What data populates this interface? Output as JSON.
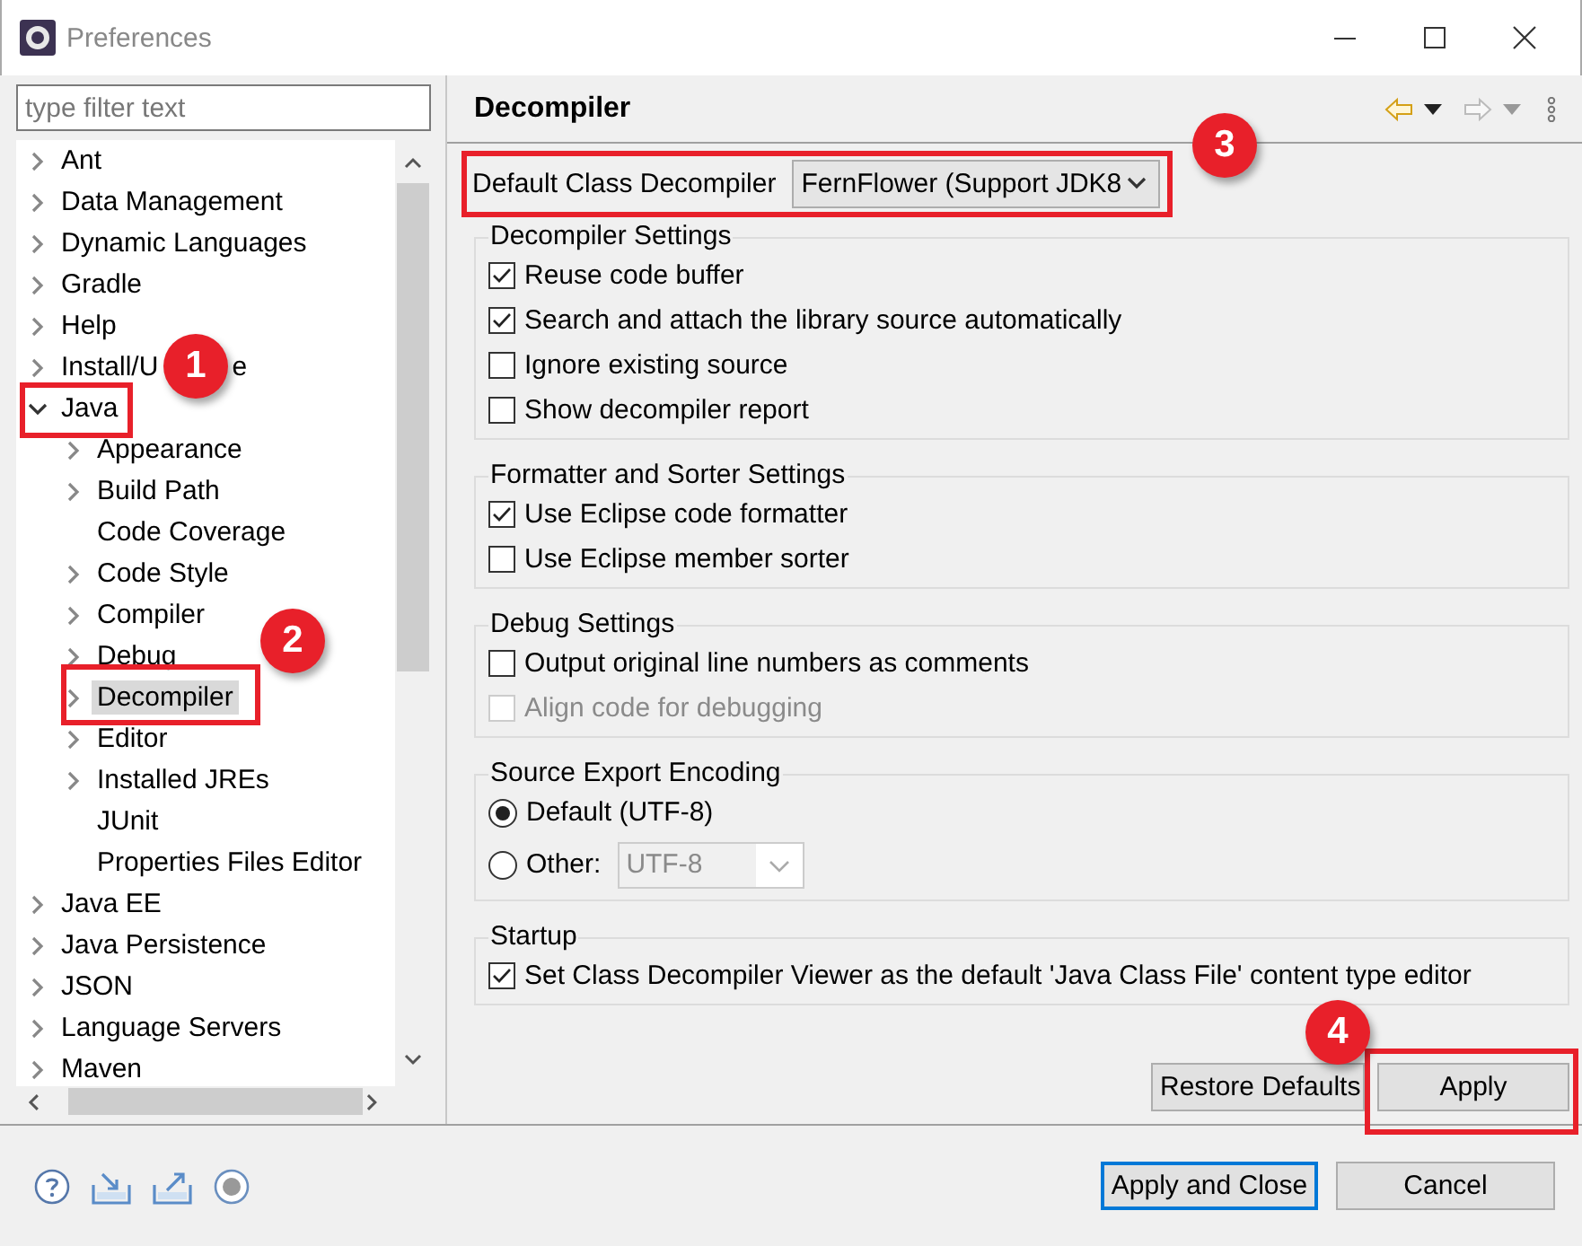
{
  "window": {
    "title": "Preferences"
  },
  "filter": {
    "placeholder": "type filter text"
  },
  "tree": [
    {
      "label": "Ant",
      "kind": "folder",
      "expanded": false,
      "selected": false
    },
    {
      "label": "Data Management",
      "kind": "folder",
      "expanded": false,
      "selected": false
    },
    {
      "label": "Dynamic Languages",
      "kind": "folder",
      "expanded": false,
      "selected": false
    },
    {
      "label": "Gradle",
      "kind": "folder",
      "expanded": false,
      "selected": false
    },
    {
      "label": "Help",
      "kind": "folder",
      "expanded": false,
      "selected": false
    },
    {
      "label": "Install/U",
      "label_tail": "e",
      "kind": "folder",
      "expanded": false,
      "selected": false
    },
    {
      "label": "Java",
      "kind": "folder",
      "expanded": true,
      "selected": false,
      "children": [
        {
          "label": "Appearance",
          "kind": "folder",
          "expanded": false,
          "selected": false
        },
        {
          "label": "Build Path",
          "kind": "folder",
          "expanded": false,
          "selected": false
        },
        {
          "label": "Code Coverage",
          "kind": "leaf",
          "selected": false
        },
        {
          "label": "Code Style",
          "kind": "folder",
          "expanded": false,
          "selected": false
        },
        {
          "label": "Compiler",
          "kind": "folder",
          "expanded": false,
          "selected": false
        },
        {
          "label": "Debug",
          "kind": "folder",
          "expanded": false,
          "selected": false
        },
        {
          "label": "Decompiler",
          "kind": "folder",
          "expanded": false,
          "selected": true
        },
        {
          "label": "Editor",
          "kind": "folder",
          "expanded": false,
          "selected": false
        },
        {
          "label": "Installed JREs",
          "kind": "folder",
          "expanded": false,
          "selected": false
        },
        {
          "label": "JUnit",
          "kind": "leaf",
          "selected": false
        },
        {
          "label": "Properties Files Editor",
          "kind": "leaf",
          "selected": false
        }
      ]
    },
    {
      "label": "Java EE",
      "kind": "folder",
      "expanded": false,
      "selected": false
    },
    {
      "label": "Java Persistence",
      "kind": "folder",
      "expanded": false,
      "selected": false
    },
    {
      "label": "JSON",
      "kind": "folder",
      "expanded": false,
      "selected": false
    },
    {
      "label": "Language Servers",
      "kind": "folder",
      "expanded": false,
      "selected": false
    },
    {
      "label": "Maven",
      "kind": "folder",
      "expanded": false,
      "selected": false
    }
  ],
  "page": {
    "title": "Decompiler"
  },
  "decompiler_choice": {
    "label": "Default Class Decompiler",
    "value": "FernFlower (Support JDK8"
  },
  "groups": [
    {
      "title": "Decompiler Settings",
      "options": [
        {
          "kind": "checkbox",
          "label": "Reuse code buffer",
          "checked": true,
          "disabled": false
        },
        {
          "kind": "checkbox",
          "label": "Search and attach the library source automatically",
          "checked": true,
          "disabled": false
        },
        {
          "kind": "checkbox",
          "label": "Ignore existing source",
          "checked": false,
          "disabled": false
        },
        {
          "kind": "checkbox",
          "label": "Show decompiler report",
          "checked": false,
          "disabled": false
        }
      ]
    },
    {
      "title": "Formatter and Sorter Settings",
      "options": [
        {
          "kind": "checkbox",
          "label": "Use Eclipse code formatter",
          "checked": true,
          "disabled": false
        },
        {
          "kind": "checkbox",
          "label": "Use Eclipse member sorter",
          "checked": false,
          "disabled": false
        }
      ]
    },
    {
      "title": "Debug Settings",
      "options": [
        {
          "kind": "checkbox",
          "label": "Output original line numbers as comments",
          "checked": false,
          "disabled": false
        },
        {
          "kind": "checkbox",
          "label": "Align code for debugging",
          "checked": false,
          "disabled": true
        }
      ]
    },
    {
      "title": "Source Export Encoding",
      "options": [
        {
          "kind": "radio",
          "label": "Default (UTF-8)",
          "selected": true
        },
        {
          "kind": "radio_select",
          "label": "Other:",
          "selected": false,
          "select": {
            "value": "UTF-8",
            "disabled": true
          }
        }
      ]
    },
    {
      "title": "Startup",
      "options": [
        {
          "kind": "checkbox",
          "label": "Set Class Decompiler Viewer as the default 'Java Class File' content type editor",
          "checked": true,
          "disabled": false
        }
      ]
    }
  ],
  "page_buttons": [
    {
      "label": "Restore Defaults"
    },
    {
      "label": "Apply"
    }
  ],
  "footer_buttons": [
    {
      "label": "Apply and Close",
      "default": true
    },
    {
      "label": "Cancel",
      "default": false
    }
  ],
  "annotations": [
    {
      "step": "1"
    },
    {
      "step": "2"
    },
    {
      "step": "3"
    },
    {
      "step": "4"
    }
  ]
}
